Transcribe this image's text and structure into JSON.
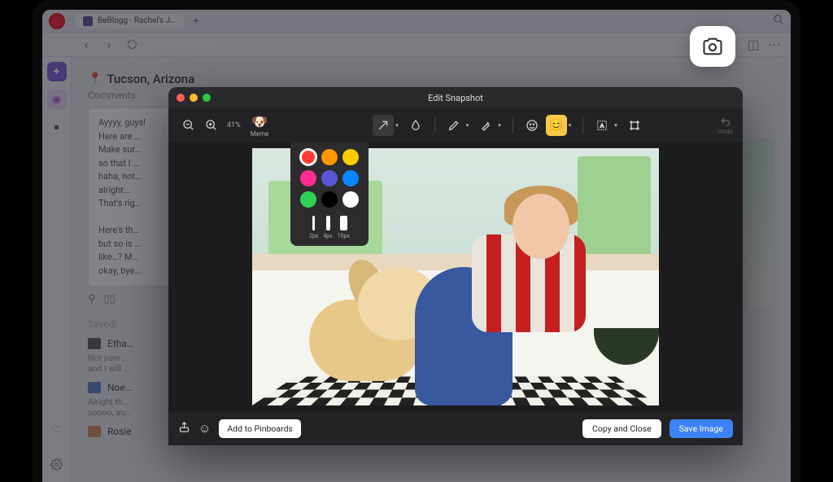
{
  "browser": {
    "tab_title": "BeBlogg · Rachel's J…",
    "add_tab": "+"
  },
  "page": {
    "location": "Tucson, Arizona",
    "comments_label": "Comments",
    "comment_body": "Ayyyy, guys!\nHere are …\nMake sur…\nso that I …\nhaha, not…\nalright… \nThat's rig…\n\nHere's th…\nbut so is …\nlike…? M…\nokay, bye…",
    "saved_label": "Saved!",
    "saved_items": [
      {
        "name": "Etha…",
        "color": "#5a5a5a",
        "sub": "Not sure …\nand I will …"
      },
      {
        "name": "Noe…",
        "color": "#5b7fc7",
        "sub": "Alright th…\nsoooo, au…"
      },
      {
        "name": "Rosie",
        "color": "#d98b5b",
        "sub": ""
      }
    ]
  },
  "editor": {
    "title": "Edit Snapshot",
    "zoom": "41%",
    "meme_label": "Meme",
    "undo_label": "Undo",
    "footer": {
      "pinboards": "Add to Pinboards",
      "copy": "Copy and Close",
      "save": "Save Image"
    },
    "picker": {
      "colors_row1": [
        "#ff3b30",
        "#ff9500",
        "#ffcc00"
      ],
      "colors_row2": [
        "#ff2d92",
        "#5856d6",
        "#0a84ff"
      ],
      "colors_row3": [
        "#30d158",
        "#000000",
        "#ffffff"
      ],
      "strokes": [
        {
          "label": "2px",
          "w": 2
        },
        {
          "label": "4px",
          "w": 4
        },
        {
          "label": "10px",
          "w": 8
        }
      ]
    }
  }
}
